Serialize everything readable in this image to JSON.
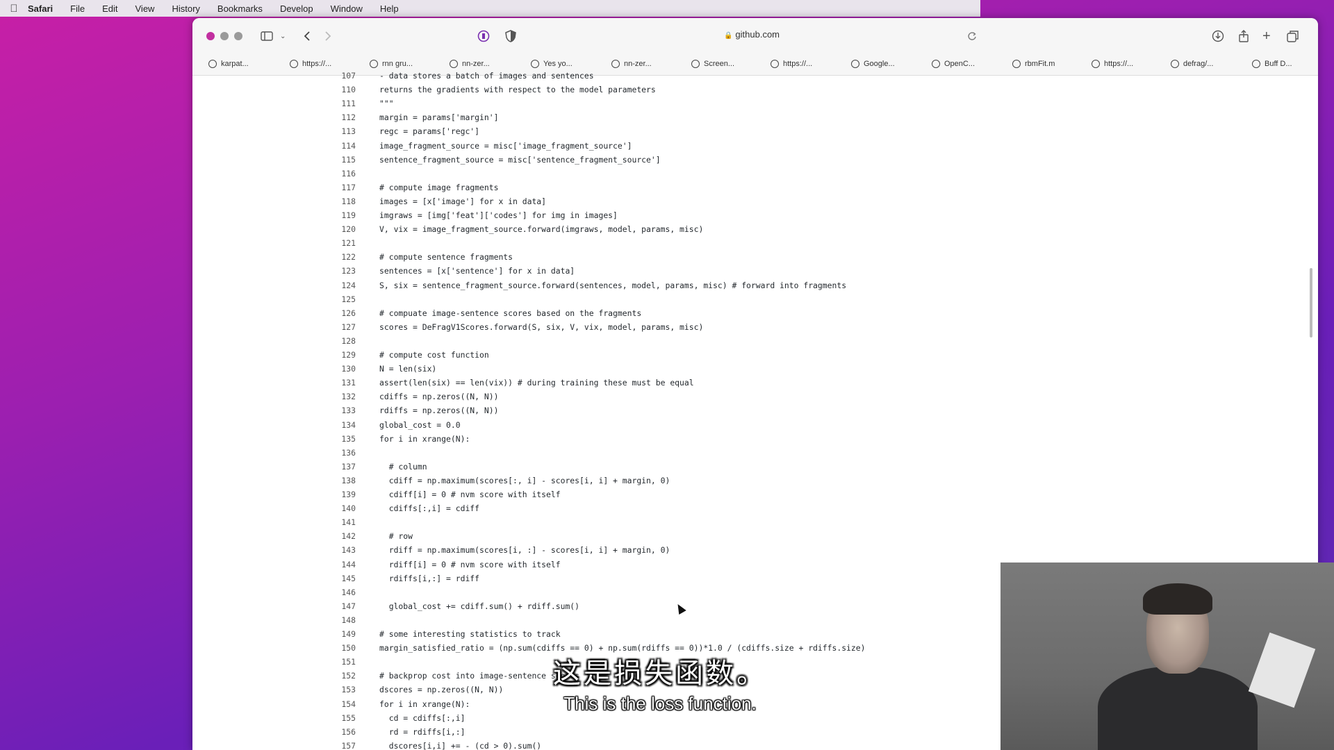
{
  "menubar": {
    "app": "Safari",
    "items": [
      "File",
      "Edit",
      "View",
      "History",
      "Bookmarks",
      "Develop",
      "Window",
      "Help"
    ]
  },
  "toolbar": {
    "url": "github.com"
  },
  "bookmarks": [
    {
      "label": "karpat...",
      "icon": "github-icon"
    },
    {
      "label": "https://...",
      "icon": "link-icon"
    },
    {
      "label": "rnn gru...",
      "icon": "google-icon"
    },
    {
      "label": "nn-zer...",
      "icon": "github-icon"
    },
    {
      "label": "Yes yo...",
      "icon": "site-icon"
    },
    {
      "label": "nn-zer...",
      "icon": "github-icon"
    },
    {
      "label": "Screen...",
      "icon": "compass-icon"
    },
    {
      "label": "https://...",
      "icon": "site-icon"
    },
    {
      "label": "Google...",
      "icon": "google-icon"
    },
    {
      "label": "OpenC...",
      "icon": "site-icon"
    },
    {
      "label": "rbmFit.m",
      "icon": "compass-icon"
    },
    {
      "label": "https://...",
      "icon": "site-icon"
    },
    {
      "label": "defrag/...",
      "icon": "github-icon"
    },
    {
      "label": "Buff D...",
      "icon": "site-icon"
    }
  ],
  "code_lines": [
    {
      "n": "107",
      "t": "- data stores a batch of images and sentences"
    },
    {
      "n": "110",
      "t": "returns the gradients with respect to the model parameters"
    },
    {
      "n": "111",
      "t": "\"\"\""
    },
    {
      "n": "112",
      "t": "margin = params['margin']"
    },
    {
      "n": "113",
      "t": "regc = params['regc']"
    },
    {
      "n": "114",
      "t": "image_fragment_source = misc['image_fragment_source']"
    },
    {
      "n": "115",
      "t": "sentence_fragment_source = misc['sentence_fragment_source']"
    },
    {
      "n": "116",
      "t": ""
    },
    {
      "n": "117",
      "t": "# compute image fragments"
    },
    {
      "n": "118",
      "t": "images = [x['image'] for x in data]"
    },
    {
      "n": "119",
      "t": "imgraws = [img['feat']['codes'] for img in images]"
    },
    {
      "n": "120",
      "t": "V, vix = image_fragment_source.forward(imgraws, model, params, misc)"
    },
    {
      "n": "121",
      "t": ""
    },
    {
      "n": "122",
      "t": "# compute sentence fragments"
    },
    {
      "n": "123",
      "t": "sentences = [x['sentence'] for x in data]"
    },
    {
      "n": "124",
      "t": "S, six = sentence_fragment_source.forward(sentences, model, params, misc) # forward into fragments"
    },
    {
      "n": "125",
      "t": ""
    },
    {
      "n": "126",
      "t": "# compuate image-sentence scores based on the fragments"
    },
    {
      "n": "127",
      "t": "scores = DeFragV1Scores.forward(S, six, V, vix, model, params, misc)"
    },
    {
      "n": "128",
      "t": ""
    },
    {
      "n": "129",
      "t": "# compute cost function"
    },
    {
      "n": "130",
      "t": "N = len(six)"
    },
    {
      "n": "131",
      "t": "assert(len(six) == len(vix)) # during training these must be equal"
    },
    {
      "n": "132",
      "t": "cdiffs = np.zeros((N, N))"
    },
    {
      "n": "133",
      "t": "rdiffs = np.zeros((N, N))"
    },
    {
      "n": "134",
      "t": "global_cost = 0.0"
    },
    {
      "n": "135",
      "t": "for i in xrange(N):"
    },
    {
      "n": "136",
      "t": ""
    },
    {
      "n": "137",
      "t": "  # column"
    },
    {
      "n": "138",
      "t": "  cdiff = np.maximum(scores[:, i] - scores[i, i] + margin, 0)"
    },
    {
      "n": "139",
      "t": "  cdiff[i] = 0 # nvm score with itself"
    },
    {
      "n": "140",
      "t": "  cdiffs[:,i] = cdiff"
    },
    {
      "n": "141",
      "t": ""
    },
    {
      "n": "142",
      "t": "  # row"
    },
    {
      "n": "143",
      "t": "  rdiff = np.maximum(scores[i, :] - scores[i, i] + margin, 0)"
    },
    {
      "n": "144",
      "t": "  rdiff[i] = 0 # nvm score with itself"
    },
    {
      "n": "145",
      "t": "  rdiffs[i,:] = rdiff"
    },
    {
      "n": "146",
      "t": ""
    },
    {
      "n": "147",
      "t": "  global_cost += cdiff.sum() + rdiff.sum()"
    },
    {
      "n": "148",
      "t": ""
    },
    {
      "n": "149",
      "t": "# some interesting statistics to track"
    },
    {
      "n": "150",
      "t": "margin_satisfied_ratio = (np.sum(cdiffs == 0) + np.sum(rdiffs == 0))*1.0 / (cdiffs.size + rdiffs.size)"
    },
    {
      "n": "151",
      "t": ""
    },
    {
      "n": "152",
      "t": "# backprop cost into image-sentence scores"
    },
    {
      "n": "153",
      "t": "dscores = np.zeros((N, N))"
    },
    {
      "n": "154",
      "t": "for i in xrange(N):"
    },
    {
      "n": "155",
      "t": "  cd = cdiffs[:,i]"
    },
    {
      "n": "156",
      "t": "  rd = rdiffs[i,:]"
    },
    {
      "n": "157",
      "t": "  dscores[i,i] += - (cd > 0).sum()"
    }
  ],
  "subtitles": {
    "chinese": "这是损失函数。",
    "english": "This is the loss function."
  }
}
